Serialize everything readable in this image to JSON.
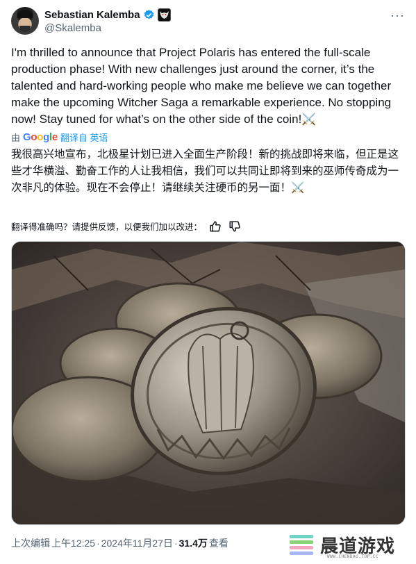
{
  "author": {
    "name": "Sebastian Kalemba",
    "handle": "@Skalemba",
    "verified_color": "#1d9bf0",
    "badges": [
      "verified-badge-icon",
      "wolf-affiliation-icon"
    ]
  },
  "header": {
    "more_label": "···"
  },
  "tweet": {
    "text": "I'm thrilled to announce that Project Polaris has entered the full-scale production phase! With new challenges just around the corner, it’s the talented and hard-working people who make me believe we can together make the upcoming Witcher Saga a remarkable experience. No stopping now! Stay tuned for what’s on the other side of the coin!⚔️"
  },
  "translation": {
    "by_label": "由",
    "google_logo": [
      "G",
      "o",
      "o",
      "g",
      "l",
      "e"
    ],
    "translated_from": "翻译自 英语",
    "text": "我很高兴地宣布，北极星计划已进入全面生产阶段！新的挑战即将来临，但正是这些才华横溢、勤奋工作的人让我相信，我们可以共同让即将到来的巫师传奇成为一次非凡的体验。现在不会停止！请继续关注硬币的另一面！⚔️",
    "feedback_prompt": "翻译得准确吗？请提供反馈，以便我们加以改进："
  },
  "media": {
    "alt": "coins-photo",
    "icon": "coin-image"
  },
  "meta": {
    "edited_label": "上次编辑",
    "time": "上午12:25",
    "separator": "·",
    "date": "2024年11月27日",
    "views_count": "31.4万",
    "views_label": "查看"
  },
  "watermark": {
    "text": "晨道游戏",
    "sub": "WWW.CHENDAO.TOP.CC"
  }
}
